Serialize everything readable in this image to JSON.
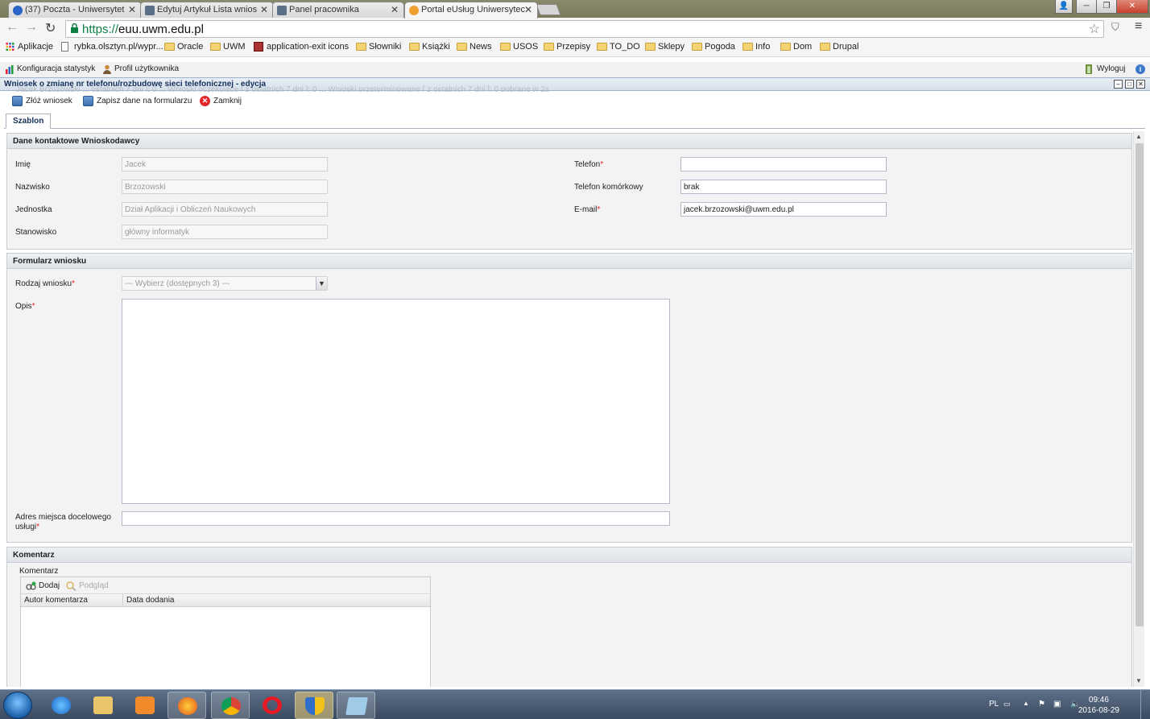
{
  "browser": {
    "tabs": [
      {
        "label": "(37) Poczta - Uniwersytet",
        "color": "#2a64c9"
      },
      {
        "label": "Edytuj Artykuł Lista wnios",
        "color": "#5b6f87"
      },
      {
        "label": "Panel pracownika",
        "color": "#5b6f87"
      },
      {
        "label": "Portal eUsług Uniwersytec",
        "color": "#f0a030"
      }
    ],
    "window_controls": [
      "user-icon",
      "minimize",
      "restore",
      "close"
    ],
    "omnibox": {
      "scheme": "https://",
      "host": "euu.uwm.edu.pl"
    },
    "bookmarks": [
      {
        "label": "Aplikacje",
        "icon": "apps-grid-icon"
      },
      {
        "label": "rybka.olsztyn.pl/wypr...",
        "icon": "page-icon"
      },
      {
        "label": "Oracle",
        "icon": "folder-icon"
      },
      {
        "label": "UWM",
        "icon": "folder-icon"
      },
      {
        "label": "application-exit icons",
        "icon": "image-icon"
      },
      {
        "label": "Słowniki",
        "icon": "folder-icon"
      },
      {
        "label": "Książki",
        "icon": "folder-icon"
      },
      {
        "label": "News",
        "icon": "folder-icon"
      },
      {
        "label": "USOS",
        "icon": "folder-icon"
      },
      {
        "label": "Przepisy",
        "icon": "folder-icon"
      },
      {
        "label": "TO_DO",
        "icon": "folder-icon"
      },
      {
        "label": "Sklepy",
        "icon": "folder-icon"
      },
      {
        "label": "Pogoda",
        "icon": "folder-icon"
      },
      {
        "label": "Info",
        "icon": "folder-icon"
      },
      {
        "label": "Dom",
        "icon": "folder-icon"
      },
      {
        "label": "Drupal",
        "icon": "folder-icon"
      }
    ]
  },
  "app": {
    "top_items": {
      "stats": "Konfiguracja statystyk",
      "profile": "Profil użytkownika",
      "logout": "Wyloguj"
    },
    "ghost_text": "Jacek Brzozowski ... ostatnich 7 dni ]: 0 ... Wnioski oczekujące [ z ostatnich 7 dni ]: 0 ... Wnioski przeterminowane [ z ostatnich 7 dni ]: 0 pobrane w 2s",
    "window_title": "Wniosek o zmianę nr telefonu/rozbudowę sieci telefonicznej - edycja",
    "toolbar": {
      "submit": "Złóż wniosek",
      "save": "Zapisz dane na formularzu",
      "close": "Zamknij"
    },
    "tab": "Szablon",
    "contact": {
      "heading": "Dane kontaktowe Wnioskodawcy",
      "first_name": {
        "label": "Imię",
        "value": "Jacek"
      },
      "last_name": {
        "label": "Nazwisko",
        "value": "Brzozowski"
      },
      "unit": {
        "label": "Jednostka",
        "value": "Dział Aplikacji i Obliczeń Naukowych"
      },
      "position": {
        "label": "Stanowisko",
        "value": "główny informatyk"
      },
      "phone": {
        "label": "Telefon",
        "value": ""
      },
      "mobile": {
        "label": "Telefon komórkowy",
        "value": "brak"
      },
      "email": {
        "label": "E-mail",
        "value": "jacek.brzozowski@uwm.edu.pl"
      }
    },
    "request_form": {
      "heading": "Formularz wniosku",
      "type": {
        "label": "Rodzaj wniosku",
        "value": "--- Wybierz (dostępnych 3) ---"
      },
      "description": {
        "label": "Opis",
        "value": ""
      },
      "address": {
        "label": "Adres miejsca docelowego usługi",
        "value": ""
      }
    },
    "comments": {
      "heading": "Komentarz",
      "sublabel": "Komentarz",
      "add": "Dodaj",
      "preview": "Podgląd",
      "columns": [
        "Autor komentarza",
        "Data dodania"
      ]
    },
    "required_marker": "*"
  },
  "taskbar": {
    "apps": [
      "ie-icon",
      "explorer-icon",
      "media-icon",
      "firefox-icon",
      "chrome-icon",
      "opera-icon",
      "security-icon",
      "window-icon"
    ],
    "lang": "PL",
    "time": "09:46",
    "date": "2016-08-29"
  }
}
